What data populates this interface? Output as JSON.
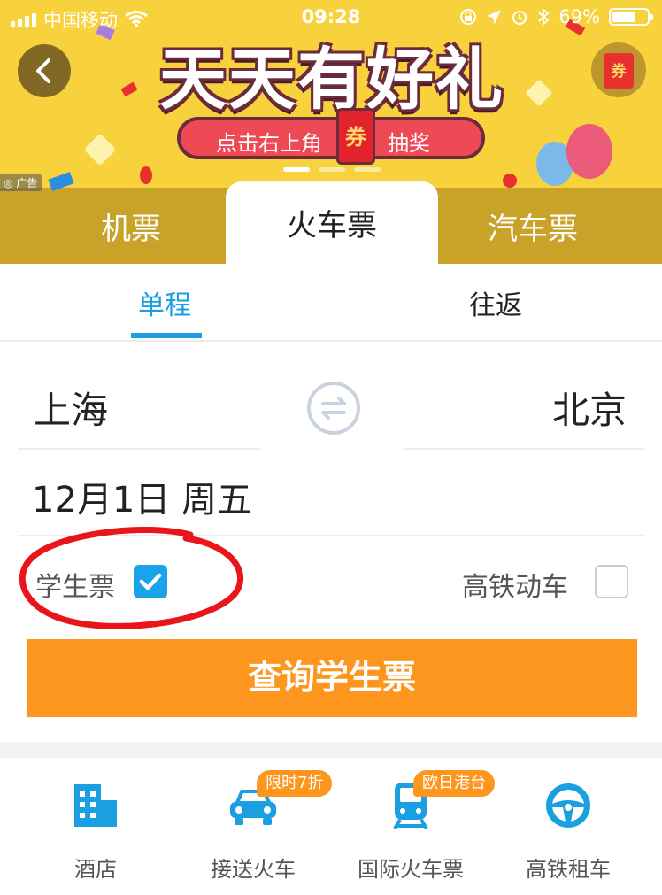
{
  "status_bar": {
    "carrier": "中国移动",
    "time": "09:28",
    "battery": "69%",
    "battery_level": 0.69
  },
  "banner": {
    "title": "天天有好礼",
    "subtitle_left": "点击右上角",
    "subtitle_tag": "券",
    "subtitle_right": "抽奖",
    "ad_label": "广告",
    "coupon_label": "券",
    "pager_active_index": 0,
    "pager_count": 3,
    "colors": {
      "background": "#f7d23c",
      "accent": "#ee4a55",
      "outline": "#6b2b3d"
    }
  },
  "tabs": [
    {
      "label": "机票",
      "selected": false
    },
    {
      "label": "火车票",
      "selected": true
    },
    {
      "label": "汽车票",
      "selected": false
    }
  ],
  "trip_type": {
    "one_way": "单程",
    "round_trip": "往返",
    "selected": "one_way"
  },
  "form": {
    "from_city": "上海",
    "to_city": "北京",
    "date": "12月1日 周五",
    "student_ticket_label": "学生票",
    "student_ticket_checked": true,
    "high_speed_label": "高铁动车",
    "high_speed_checked": false,
    "search_button": "查询学生票"
  },
  "services": [
    {
      "label": "酒店",
      "icon": "building-icon",
      "badge": ""
    },
    {
      "label": "接送火车",
      "icon": "car-icon",
      "badge": "限时7折"
    },
    {
      "label": "国际火车票",
      "icon": "train-icon",
      "badge": "欧日港台"
    },
    {
      "label": "高铁租车",
      "icon": "steering-wheel-icon",
      "badge": ""
    }
  ],
  "colors": {
    "primary_blue": "#1a9fe0",
    "search_orange": "#fc961f",
    "annotation_red": "#e8151b"
  }
}
